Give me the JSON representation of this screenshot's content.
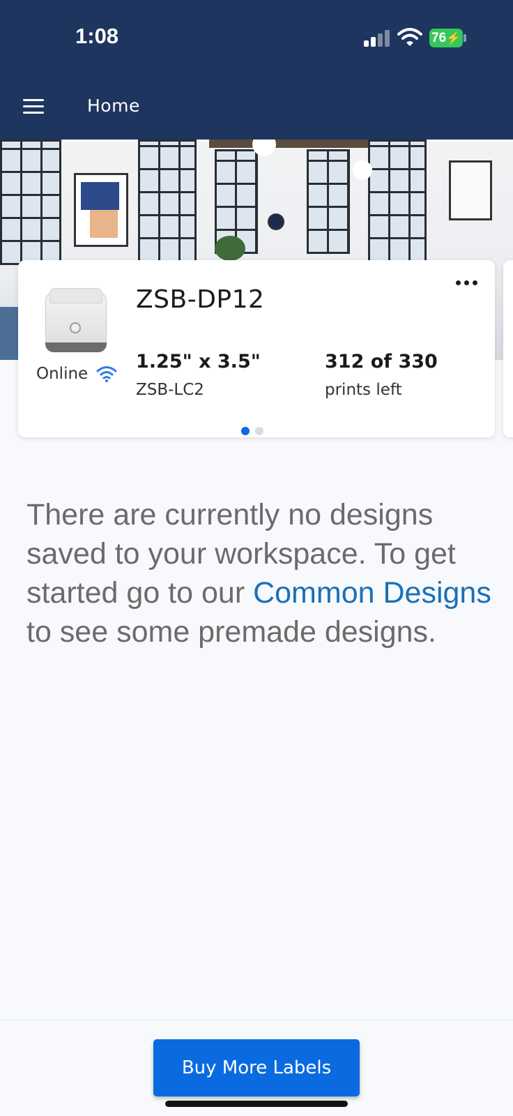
{
  "status_bar": {
    "time": "1:08",
    "battery": "76"
  },
  "header": {
    "title": "Home"
  },
  "printer_card": {
    "name": "ZSB-DP12",
    "status": "Online",
    "label_size": "1.25\" x 3.5\"",
    "label_model": "ZSB-LC2",
    "prints_count": "312 of 330",
    "prints_caption": "prints left"
  },
  "pager": {
    "active_index": 0,
    "count": 2
  },
  "empty_state": {
    "text_before": "There are currently no designs saved to your workspace. To get started go to our ",
    "link_text": "Common Designs",
    "text_after": " to see some premade designs."
  },
  "footer": {
    "buy_button_label": "Buy More Labels"
  },
  "colors": {
    "header_bg": "#1e3560",
    "accent": "#0a6be0",
    "link": "#1b6fb8",
    "battery": "#34c759"
  }
}
